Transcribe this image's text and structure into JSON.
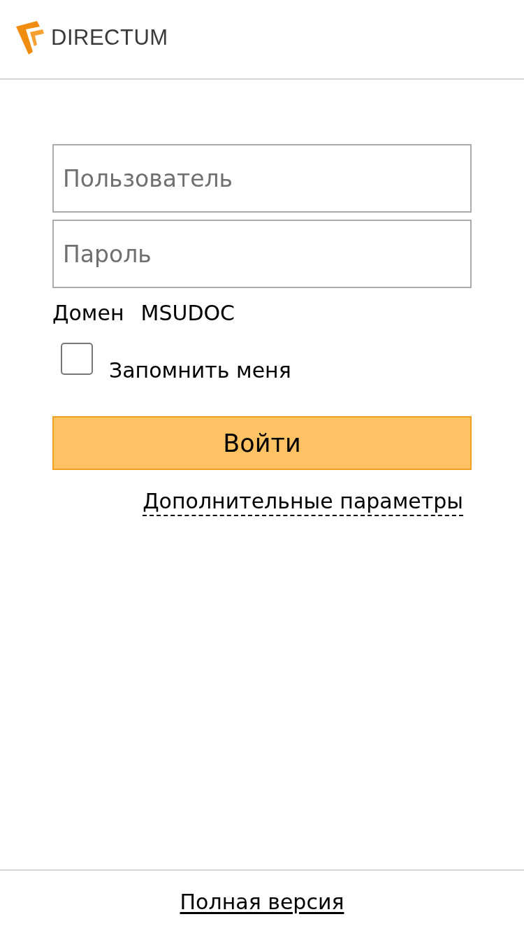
{
  "header": {
    "logo_text": "DIRECTUM"
  },
  "login_form": {
    "username": {
      "placeholder": "Пользователь"
    },
    "password": {
      "placeholder": "Пароль"
    },
    "domain": {
      "label": "Домен",
      "value": "MSUDOC"
    },
    "remember_me": {
      "label": "Запомнить меня",
      "checked": false
    },
    "submit_button": "Войти",
    "advanced_link": "Дополнительные параметры"
  },
  "footer": {
    "full_version_link": "Полная версия"
  }
}
